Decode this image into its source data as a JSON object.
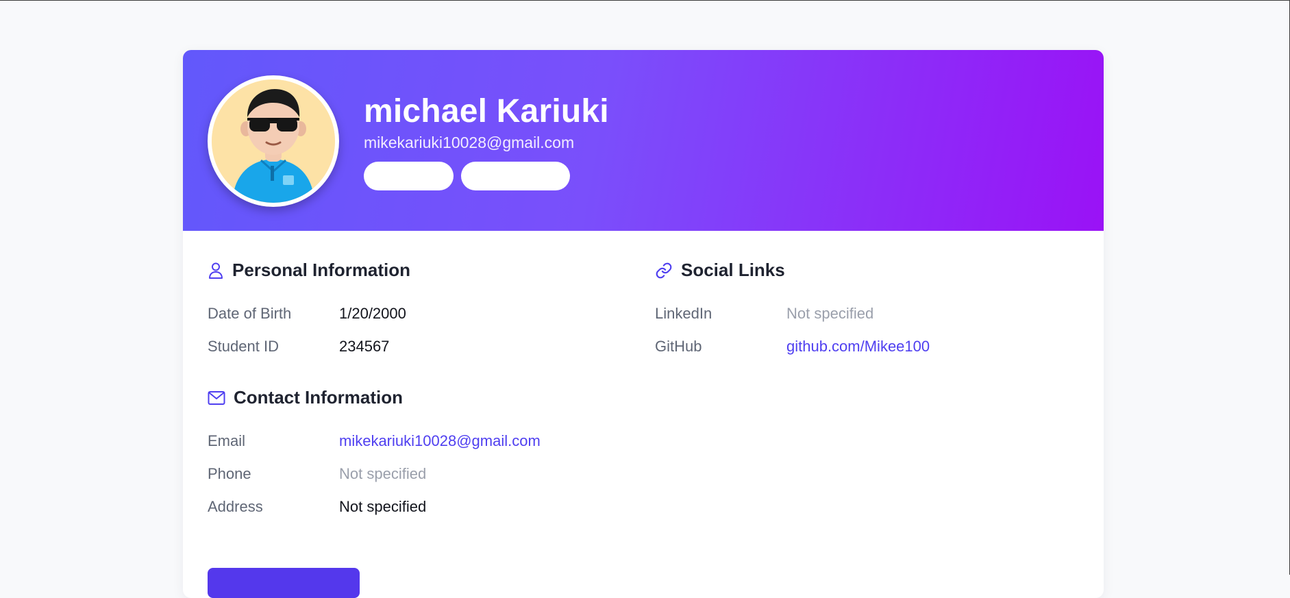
{
  "profile": {
    "name": "michael Kariuki",
    "email": "mikekariuki10028@gmail.com",
    "avatar_icon": "avatar-illustration",
    "badges": [
      "",
      ""
    ]
  },
  "colors": {
    "gradient_start": "#6258fb",
    "gradient_end": "#9a12f6",
    "accent": "#4f3ff0",
    "muted_text": "#9a9fab"
  },
  "personal": {
    "icon": "user-icon",
    "title": "Personal Information",
    "rows": [
      {
        "label": "Date of Birth",
        "value": "1/20/2000"
      },
      {
        "label": "Student ID",
        "value": "234567"
      }
    ]
  },
  "contact": {
    "icon": "mail-icon",
    "title": "Contact Information",
    "rows": [
      {
        "label": "Email",
        "value": "mikekariuki10028@gmail.com"
      },
      {
        "label": "Phone",
        "value": "Not specified"
      },
      {
        "label": "Address",
        "value": "Not specified"
      }
    ]
  },
  "social": {
    "icon": "link-icon",
    "title": "Social Links",
    "rows": [
      {
        "label": "LinkedIn",
        "value": "Not specified"
      },
      {
        "label": "GitHub",
        "value": "github.com/Mikee100"
      }
    ]
  }
}
